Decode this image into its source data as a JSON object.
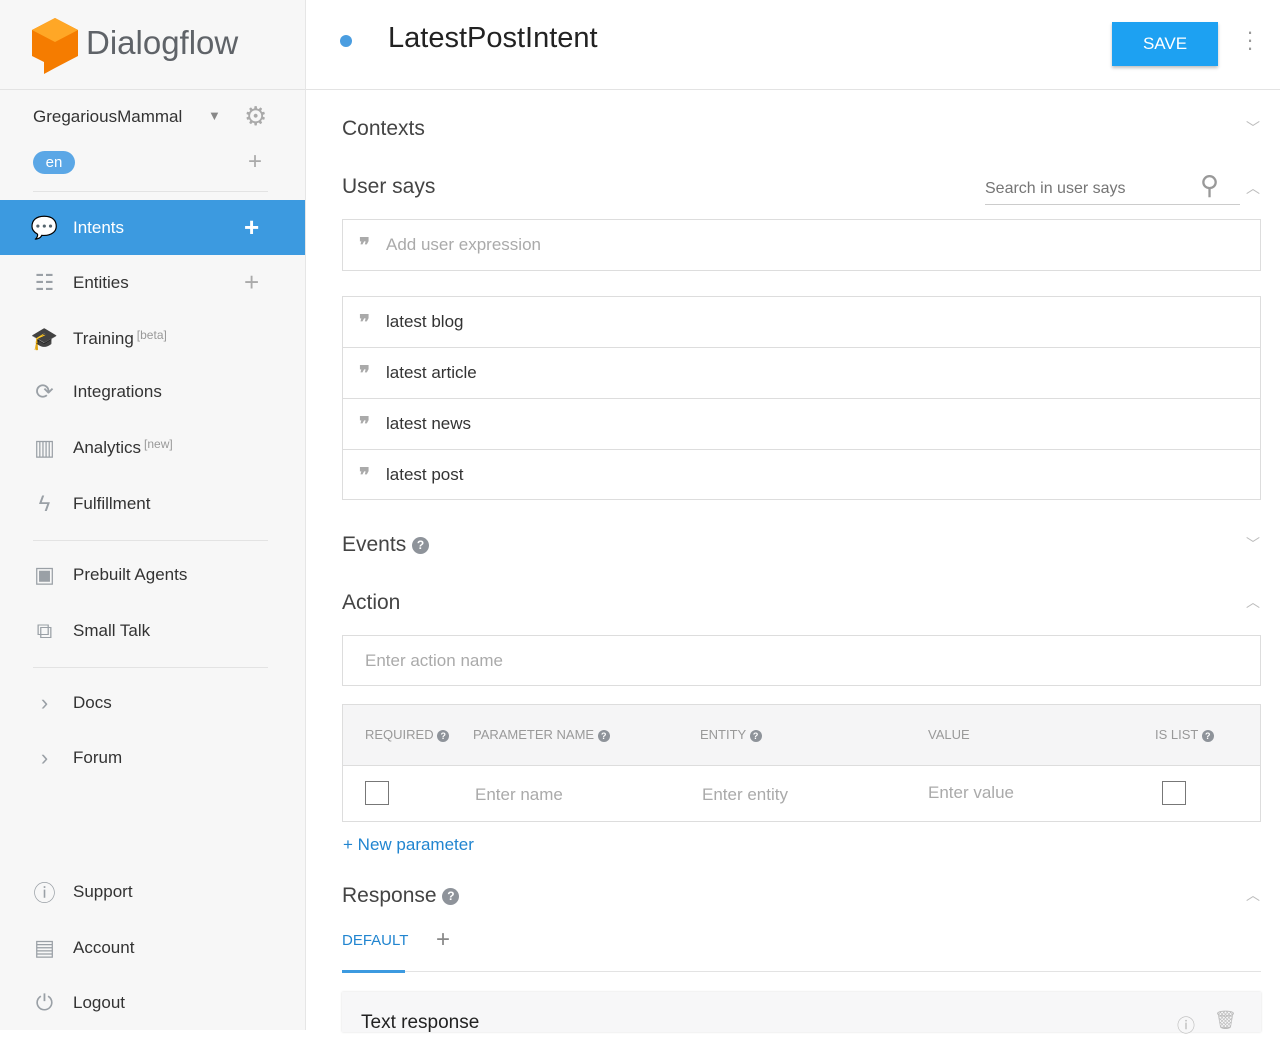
{
  "brand": {
    "name": "Dialogflow"
  },
  "agent": {
    "name": "GregariousMammal",
    "language": "en"
  },
  "nav": [
    {
      "label": "Intents",
      "icon": "chat-icon",
      "plus": true
    },
    {
      "label": "Entities",
      "icon": "hierarchy-icon",
      "plus": true
    },
    {
      "label": "Training",
      "badge": "[beta]",
      "icon": "graduation-cap-icon"
    },
    {
      "label": "Integrations",
      "icon": "refresh-icon"
    },
    {
      "label": "Analytics",
      "badge": "[new]",
      "icon": "bar-chart-icon"
    },
    {
      "label": "Fulfillment",
      "icon": "bolt-icon"
    },
    {
      "label": "Prebuilt Agents",
      "icon": "book-icon"
    },
    {
      "label": "Small Talk",
      "icon": "chat-bubbles-icon"
    },
    {
      "label": "Docs",
      "icon": "chevron-right-icon"
    },
    {
      "label": "Forum",
      "icon": "chevron-right-icon"
    },
    {
      "label": "Support",
      "icon": "help-circle-icon"
    },
    {
      "label": "Account",
      "icon": "account-icon"
    },
    {
      "label": "Logout",
      "icon": "power-icon"
    }
  ],
  "header": {
    "title": "LatestPostIntent",
    "save": "SAVE"
  },
  "sections": {
    "contexts": "Contexts",
    "user_says": "User says",
    "events": "Events",
    "action": "Action",
    "response": "Response"
  },
  "user_says": {
    "search_placeholder": "Search in user says",
    "add_placeholder": "Add user expression",
    "items": [
      "latest blog",
      "latest article",
      "latest news",
      "latest post"
    ]
  },
  "action": {
    "placeholder": "Enter action name"
  },
  "params": {
    "headers": [
      "REQUIRED",
      "PARAMETER NAME",
      "ENTITY",
      "VALUE",
      "IS LIST"
    ],
    "name_ph": "Enter name",
    "entity_ph": "Enter entity",
    "value_ph": "Enter value",
    "new": "New parameter"
  },
  "response": {
    "tab": "DEFAULT",
    "card_title": "Text response"
  }
}
